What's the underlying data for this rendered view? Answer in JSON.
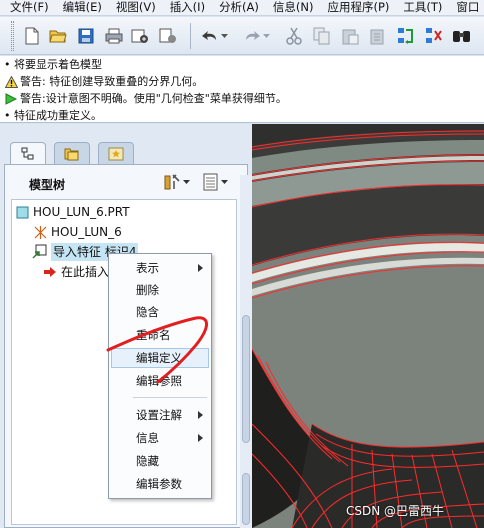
{
  "menu": [
    "文件(F)",
    "编辑(E)",
    "视图(V)",
    "插入(I)",
    "分析(A)",
    "信息(N)",
    "应用程序(P)",
    "工具(T)",
    "窗口"
  ],
  "toolbar": {
    "icons": [
      "new-icon",
      "open-icon",
      "save-icon",
      "print-icon",
      "send-mail-icon",
      "send-icon",
      "undo-icon",
      "redo-icon",
      "cut-icon",
      "copy-icon",
      "paste-icon",
      "paste-special-icon",
      "regenerate-icon",
      "regen-manager-icon",
      "find-icon"
    ]
  },
  "messages": [
    {
      "type": "info",
      "text": "• 将要显示着色模型"
    },
    {
      "type": "warning",
      "text": "警告: 特征创建导致重叠的分界几何。"
    },
    {
      "type": "warning-arrow",
      "text": "警告:设计意图不明确。使用\"几何检查\"菜单获得细节。"
    },
    {
      "type": "info",
      "text": "• 特征成功重定义。"
    }
  ],
  "navigator": {
    "tabs": [
      "model-tree-tab",
      "folder-browser-tab",
      "favorites-tab"
    ],
    "title": "模型树",
    "tree": [
      {
        "label": "HOU_LUN_6.PRT",
        "icon": "part-icon",
        "level": 0
      },
      {
        "label": "HOU_LUN_6",
        "icon": "coordinate-system-icon",
        "level": 1
      },
      {
        "label": "导入特征 标识4",
        "icon": "import-feature-icon",
        "level": 1,
        "selected": true
      },
      {
        "label": "在此插入",
        "icon": "insert-here-arrow-icon",
        "level": 2
      }
    ]
  },
  "context_menu": {
    "items": [
      {
        "label": "表示",
        "submenu": true
      },
      {
        "label": "删除",
        "submenu": false
      },
      {
        "label": "隐含",
        "submenu": false
      },
      {
        "label": "重命名",
        "submenu": false
      },
      {
        "label": "编辑定义",
        "submenu": false,
        "highlighted": true
      },
      {
        "label": "编辑参照",
        "submenu": false
      },
      {
        "separator": true
      },
      {
        "label": "设置注解",
        "submenu": true
      },
      {
        "label": "信息",
        "submenu": true
      },
      {
        "label": "隐藏",
        "submenu": false
      },
      {
        "label": "编辑参数",
        "submenu": false
      }
    ]
  },
  "watermark": "CSDN @巴雷西牛",
  "colors": {
    "accent": "#e02020",
    "selection": "#c6e5f4",
    "model_lines": "#ff2a2a"
  }
}
